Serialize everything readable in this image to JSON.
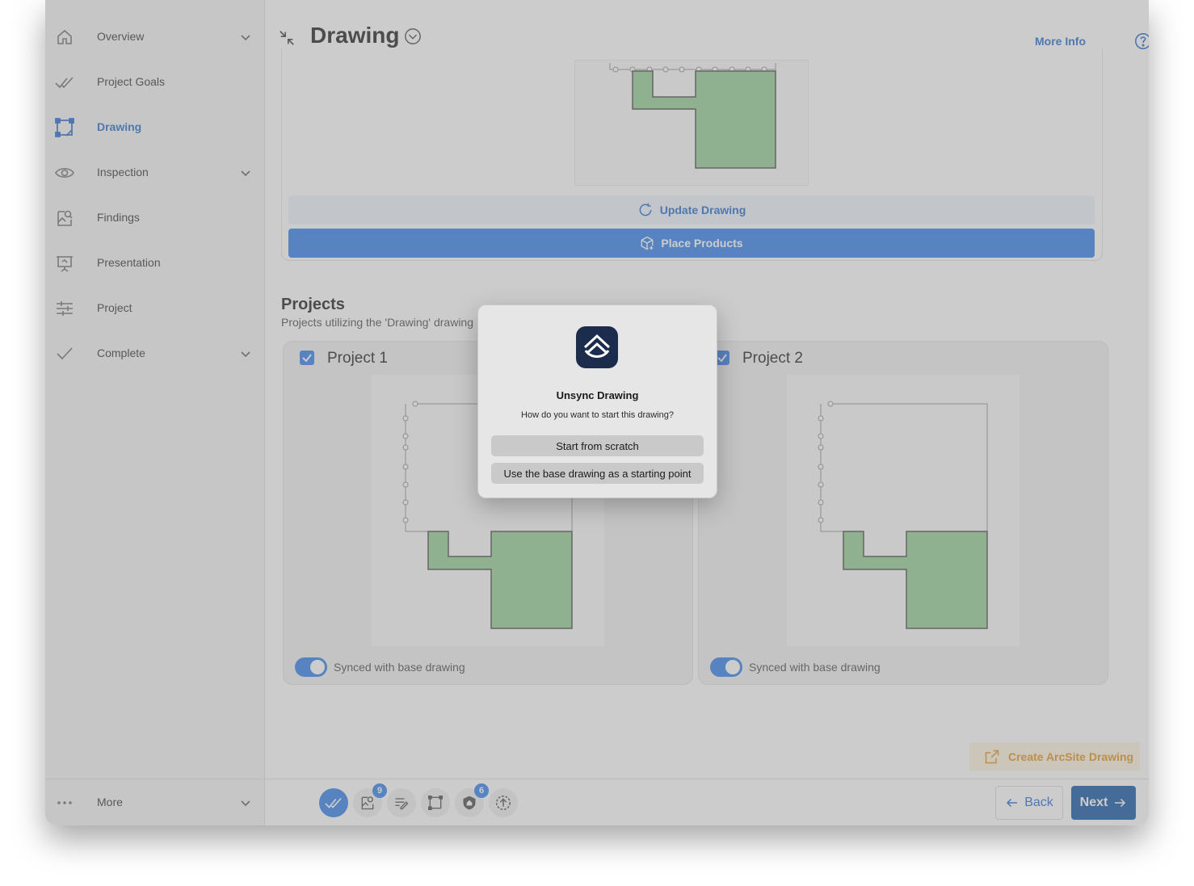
{
  "sidebar": {
    "items": [
      {
        "label": "Overview",
        "icon": "home-icon"
      },
      {
        "label": "Project Goals",
        "icon": "double-check-icon"
      },
      {
        "label": "Drawing",
        "icon": "drawing-icon"
      },
      {
        "label": "Inspection",
        "icon": "eye-icon"
      },
      {
        "label": "Findings",
        "icon": "findings-icon"
      },
      {
        "label": "Presentation",
        "icon": "presentation-icon"
      },
      {
        "label": "Project",
        "icon": "sliders-icon"
      },
      {
        "label": "Complete",
        "icon": "check-icon"
      }
    ],
    "more_label": "More"
  },
  "header": {
    "title": "Drawing",
    "more_info": "More Info"
  },
  "drawing_card": {
    "update_label": "Update Drawing",
    "place_label": "Place Products"
  },
  "projects": {
    "title": "Projects",
    "subtitle": "Projects utilizing the 'Drawing' drawing",
    "cards": [
      {
        "title": "Project 1",
        "sync_label": "Synced with base drawing"
      },
      {
        "title": "Project 2",
        "sync_label": "Synced with base drawing"
      }
    ]
  },
  "create_label": "Create ArcSite Drawing",
  "toolbar": {
    "badges": [
      "9",
      "6"
    ]
  },
  "nav": {
    "back_label": "Back",
    "next_label": "Next"
  },
  "dialog": {
    "title": "Unsync Drawing",
    "message": "How do you want to start this drawing?",
    "option_scratch": "Start from scratch",
    "option_base": "Use the base drawing as a starting point"
  },
  "colors": {
    "accent": "#3d86ec",
    "accent_text": "#2f74d0",
    "create_orange": "#e59a2b",
    "product_fill": "#9ad39b"
  }
}
